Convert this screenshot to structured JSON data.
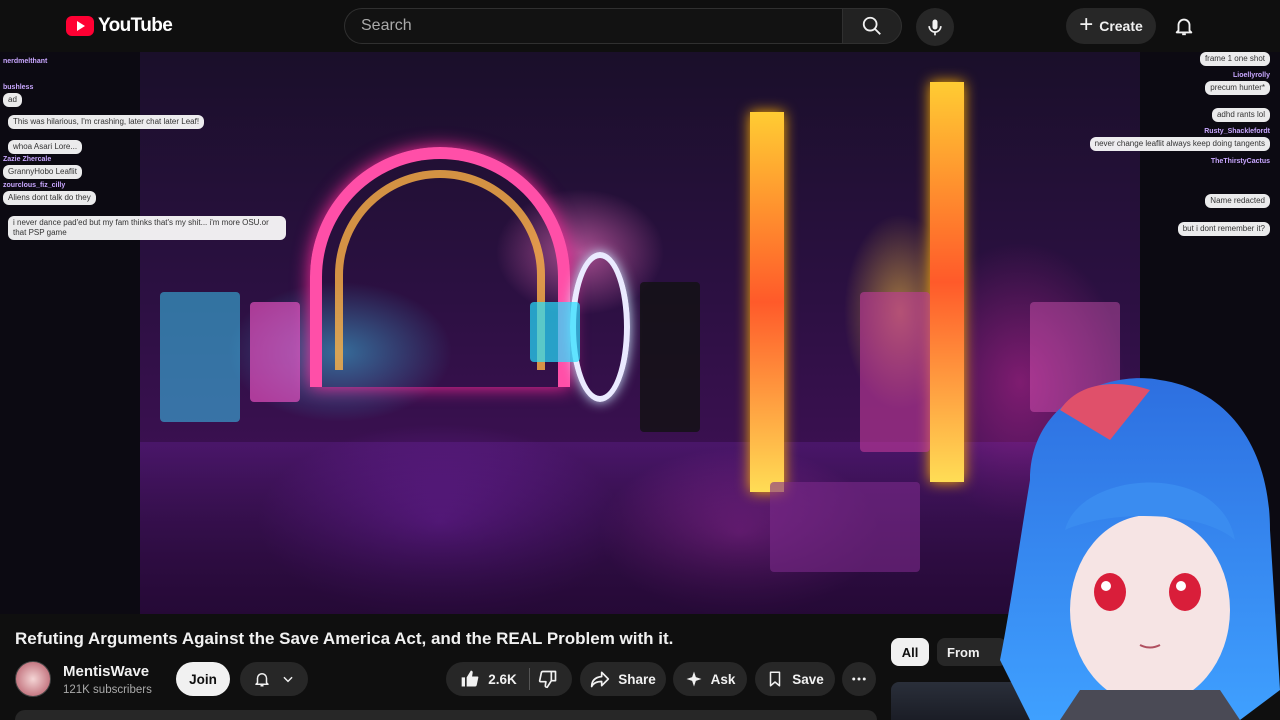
{
  "header": {
    "logo_text": "YouTube",
    "search_placeholder": "Search",
    "create_label": "Create"
  },
  "chat_left": [
    {
      "user": "nerdmelthant",
      "text": ""
    },
    {
      "user": "bushless",
      "text": "ad"
    },
    {
      "user": "",
      "text": "This was hilarious, I'm crashing, later chat later Leaf!"
    },
    {
      "user": "",
      "text": "whoa Asari Lore..."
    },
    {
      "user": "Zazie Zhercale",
      "text": "GrannyHobo Leaflit"
    },
    {
      "user": "zourclous_fiz_cilly",
      "text": "Aliens dont talk do they"
    },
    {
      "user": "",
      "text": "i never dance pad'ed but my fam thinks that's my shit... i'm more OSU.or that PSP game"
    }
  ],
  "chat_right": [
    {
      "user": "",
      "text": "frame 1 one shot"
    },
    {
      "user": "Lioellyrolly",
      "text": "precum hunter*"
    },
    {
      "user": "",
      "text": "adhd rants lol"
    },
    {
      "user": "Rusty_Shacklefordt",
      "text": "never change leaflit always keep doing tangents"
    },
    {
      "user": "TheThirstyCactus",
      "text": ""
    },
    {
      "user": "",
      "text": "Name redacted"
    },
    {
      "user": "",
      "text": "but i dont remember it?"
    }
  ],
  "video": {
    "title": "Refuting Arguments Against the Save America Act, and the REAL Problem with it."
  },
  "channel": {
    "name": "MentisWave",
    "subscribers": "121K subscribers",
    "join_label": "Join"
  },
  "actions": {
    "like_count": "2.6K",
    "share_label": "Share",
    "ask_label": "Ask",
    "save_label": "Save"
  },
  "sidebar": {
    "chips": [
      "All",
      "From"
    ]
  },
  "colors": {
    "accent_red": "#ff0033",
    "background": "#0f0f0f",
    "pill": "#272727"
  }
}
